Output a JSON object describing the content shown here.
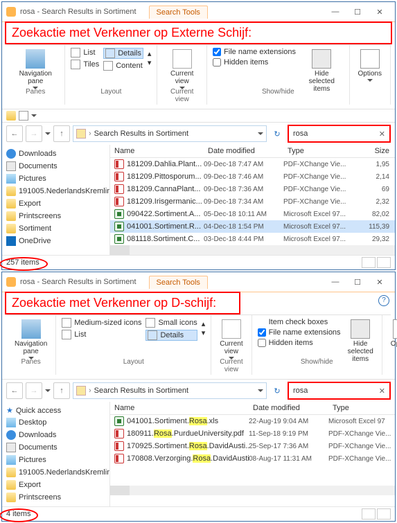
{
  "annot1": "Zoekactie met Verkenner op Externe Schijf:",
  "annot2": "Zoekactie met Verkenner op D-schijf:",
  "win": {
    "title": "rosa - Search Results in Sortiment",
    "tab": "Search Tools",
    "btn_min": "—",
    "btn_max": "☐",
    "btn_close": "✕",
    "help": "?"
  },
  "ribbon": {
    "panes": "Panes",
    "layout": "Layout",
    "curview": "Current view",
    "showhide": "Show/hide",
    "nav": "Navigation\npane",
    "curv": "Current\nview",
    "hide": "Hide selected\nitems",
    "opt": "Options",
    "list": "List",
    "tiles": "Tiles",
    "details": "Details",
    "content": "Content",
    "med": "Medium-sized icons",
    "small": "Small icons",
    "itemcb": "Item check boxes",
    "fne": "File name extensions",
    "hid": "Hidden items"
  },
  "addr": {
    "path": "Search Results in Sortiment",
    "search": "rosa"
  },
  "cols": {
    "name": "Name",
    "date": "Date modified",
    "type": "Type",
    "size": "Size"
  },
  "tree1": [
    {
      "icon": "dl",
      "label": "Downloads"
    },
    {
      "icon": "doc",
      "label": "Documents"
    },
    {
      "icon": "pic",
      "label": "Pictures"
    },
    {
      "icon": "fld",
      "label": "191005.NederlandsKremlin"
    },
    {
      "icon": "fld",
      "label": "Export"
    },
    {
      "icon": "fld",
      "label": "Printscreens"
    },
    {
      "icon": "fld",
      "label": "Sortiment"
    },
    {
      "icon": "odr",
      "label": "OneDrive"
    }
  ],
  "files1": [
    {
      "icon": "pdf",
      "name": "181209.Dahlia.Plant...",
      "date": "09-Dec-18 7:47 AM",
      "type": "PDF-XChange Vie...",
      "size": "1,95"
    },
    {
      "icon": "pdf",
      "name": "181209.Pittosporum...",
      "date": "09-Dec-18 7:46 AM",
      "type": "PDF-XChange Vie...",
      "size": "2,14"
    },
    {
      "icon": "pdf",
      "name": "181209.CannaPlant...",
      "date": "09-Dec-18 7:36 AM",
      "type": "PDF-XChange Vie...",
      "size": "69"
    },
    {
      "icon": "pdf",
      "name": "181209.Irisgermanic...",
      "date": "09-Dec-18 7:34 AM",
      "type": "PDF-XChange Vie...",
      "size": "2,32"
    },
    {
      "icon": "xls",
      "name": "090422.Sortiment.A...",
      "date": "05-Dec-18 10:11 AM",
      "type": "Microsoft Excel 97...",
      "size": "82,02"
    },
    {
      "icon": "xls",
      "name": "041001.Sortiment.R...",
      "date": "04-Dec-18 1:54 PM",
      "type": "Microsoft Excel 97...",
      "size": "115,39",
      "sel": true
    },
    {
      "icon": "xls",
      "name": "081118.Sortiment.C...",
      "date": "03-Dec-18 4:44 PM",
      "type": "Microsoft Excel 97...",
      "size": "29,32"
    }
  ],
  "status1": "257 items",
  "tree2": [
    {
      "icon": "star",
      "label": "Quick access"
    },
    {
      "icon": "pic",
      "label": "Desktop"
    },
    {
      "icon": "dl",
      "label": "Downloads"
    },
    {
      "icon": "doc",
      "label": "Documents"
    },
    {
      "icon": "pic",
      "label": "Pictures"
    },
    {
      "icon": "fld",
      "label": "191005.NederlandsKremlin"
    },
    {
      "icon": "fld",
      "label": "Export"
    },
    {
      "icon": "fld",
      "label": "Printscreens"
    }
  ],
  "files2": [
    {
      "icon": "xls",
      "pre": "041001.Sortiment.",
      "hl": "Rosa",
      "post": ".xls",
      "date": "22-Aug-19 9:04 AM",
      "type": "Microsoft Excel 97"
    },
    {
      "icon": "pdf",
      "pre": "180911.",
      "hl": "Rosa",
      "post": ".PurdueUniversity.pdf",
      "date": "11-Sep-18 9:19 PM",
      "type": "PDF-XChange Vie..."
    },
    {
      "icon": "pdf",
      "pre": "170925.Sortiment.",
      "hl": "Rosa",
      "post": ".DavidAusti...",
      "date": "25-Sep-17 7:36 AM",
      "type": "PDF-XChange Vie..."
    },
    {
      "icon": "pdf",
      "pre": "170808.Verzorging.",
      "hl": "Rosa",
      "post": ".DavidAusti...",
      "date": "08-Aug-17 11:31 AM",
      "type": "PDF-XChange Vie..."
    }
  ],
  "status2": "4 items"
}
